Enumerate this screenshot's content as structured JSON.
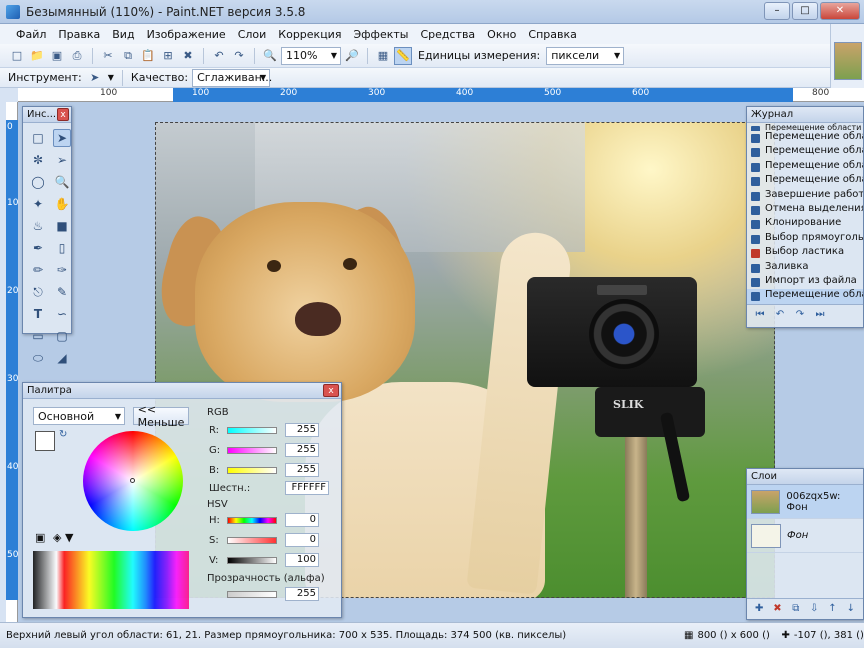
{
  "window": {
    "title": "Безымянный (110%) - Paint.NET версия 3.5.8"
  },
  "menu": [
    "Файл",
    "Правка",
    "Вид",
    "Изображение",
    "Слои",
    "Коррекция",
    "Эффекты",
    "Средства",
    "Окно",
    "Справка"
  ],
  "toolbar": {
    "zoom_value": "110%",
    "units_label": "Единицы измерения:",
    "units_value": "пиксели"
  },
  "toolbar2": {
    "instrument_label": "Инструмент:",
    "quality_label": "Качество:",
    "quality_value": "Сглаживан..."
  },
  "ruler": {
    "h_labels": [
      "100",
      "0",
      "100",
      "200",
      "300",
      "400",
      "500",
      "600",
      "700",
      "800"
    ],
    "v_labels": [
      "0",
      "100",
      "200",
      "300",
      "400",
      "500"
    ]
  },
  "tools_panel": {
    "title": "Инс..."
  },
  "history_panel": {
    "title": "Журнал",
    "items": [
      "Перемещение области",
      "Перемещение области",
      "Перемещение области",
      "Перемещение области",
      "Перемещение области",
      "Завершение работы с...",
      "Отмена выделения",
      "Клонирование",
      "Выбор прямоугольной...",
      "Выбор ластика",
      "Заливка",
      "Импорт из файла",
      "Перемещение области"
    ]
  },
  "layers_panel": {
    "title": "Слои",
    "layers": [
      "006zqx5w: Фон",
      "Фон"
    ]
  },
  "palette_panel": {
    "title": "Палитра",
    "mode_value": "Основной",
    "less_button": "<< Меньше",
    "rgb_label": "RGB",
    "r_label": "R:",
    "r_value": "255",
    "g_label": "G:",
    "g_value": "255",
    "b_label": "B:",
    "b_value": "255",
    "hex_label": "Шестн.:",
    "hex_value": "FFFFFF",
    "hsv_label": "HSV",
    "h_label": "H:",
    "h_value": "0",
    "s_label": "S:",
    "s_value": "0",
    "v_label": "V:",
    "v_value": "100",
    "alpha_label": "Прозрачность (альфа)",
    "alpha_value": "255"
  },
  "canvas": {
    "camera_brand": "SLIK"
  },
  "status": {
    "text": "Верхний левый угол области: 61, 21. Размер прямоугольника: 700 x 535. Площадь: 374 500 (кв. пикселы)",
    "image_size": "800 () x 600 ()",
    "cursor": "-107 (), 381 ()"
  }
}
